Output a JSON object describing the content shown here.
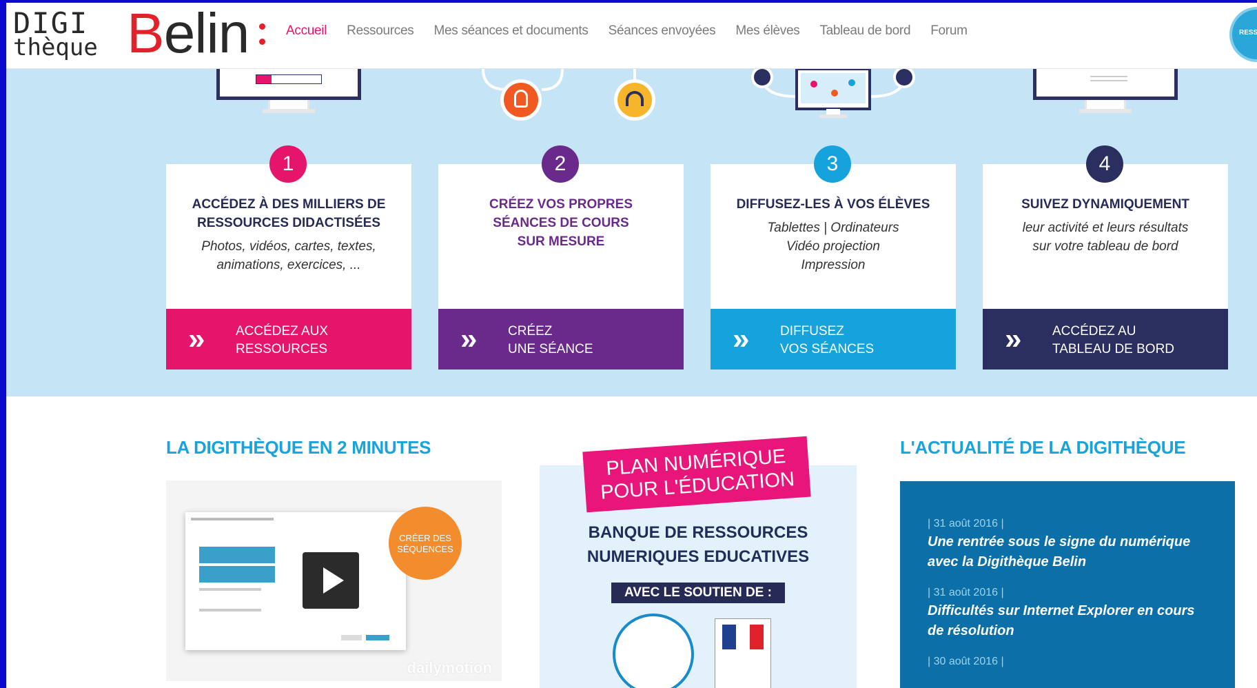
{
  "logo": {
    "top": "DIGI",
    "bottom": "thèque",
    "brand_first": "B",
    "brand_rest": "elin"
  },
  "nav": [
    {
      "label": "Accueil",
      "active": true
    },
    {
      "label": "Ressources"
    },
    {
      "label": "Mes séances et documents"
    },
    {
      "label": "Séances envoyées"
    },
    {
      "label": "Mes élèves"
    },
    {
      "label": "Tableau de bord"
    },
    {
      "label": "Forum"
    }
  ],
  "badge": {
    "text": "RESS NUM"
  },
  "cards": [
    {
      "number": "1",
      "color": "#e5156b",
      "title_lines": [
        "ACCÉDEZ À DES MILLIERS DE",
        "RESSOURCES DIDACTISÉES"
      ],
      "sub_lines": [
        "Photos, vidéos, cartes, textes,",
        "animations, exercices, ..."
      ],
      "cta_icon": "»",
      "cta_l1": "ACCÉDEZ AUX",
      "cta_l2": "RESSOURCES"
    },
    {
      "number": "2",
      "color": "#6a2a8c",
      "title_lines": [
        "CRÉEZ VOS PROPRES",
        "SÉANCES DE COURS",
        "SUR MESURE"
      ],
      "sub_lines": [],
      "cta_icon": "»",
      "cta_l1": "CRÉEZ",
      "cta_l2": "UNE SÉANCE"
    },
    {
      "number": "3",
      "color": "#16a3dc",
      "title_lines": [
        "DIFFUSEZ-LES À VOS ÉLÈVES"
      ],
      "sub_lines": [
        "Tablettes | Ordinateurs",
        "Vidéo projection",
        "Impression"
      ],
      "cta_icon": "»",
      "cta_l1": "DIFFUSEZ",
      "cta_l2": "VOS SÉANCES"
    },
    {
      "number": "4",
      "color": "#2b2f5f",
      "title_lines": [
        "SUIVEZ DYNAMIQUEMENT"
      ],
      "sub_lines": [
        "leur activité et leurs résultats",
        "sur votre tableau de bord"
      ],
      "cta_icon": "»",
      "cta_l1": "ACCÉDEZ AU",
      "cta_l2": "TABLEAU DE BORD"
    }
  ],
  "video_section": {
    "title": "LA DIGITHÈQUE EN 2 MINUTES",
    "orange_l1": "CRÉER DES",
    "orange_l2": "SÉQUENCES",
    "watermark": "dailymotion"
  },
  "plan": {
    "pink_l1": "PLAN NUMÉRIQUE",
    "pink_l2": "POUR L'ÉDUCATION",
    "bank_l1": "BANQUE DE RESSOURCES",
    "bank_l2": "NUMERIQUES EDUCATIVES",
    "avec": "AVEC LE SOUTIEN DE :"
  },
  "news": {
    "title": "L'ACTUALITÉ DE LA DIGITHÈQUE",
    "items": [
      {
        "date": "| 31 août 2016 |",
        "title": "Une rentrée sous le signe du numérique avec la Digithèque Belin"
      },
      {
        "date": "| 31 août 2016 |",
        "title": "Difficultés sur Internet Explorer en cours de résolution"
      },
      {
        "date": "| 30 août 2016 |",
        "title": ""
      }
    ]
  }
}
